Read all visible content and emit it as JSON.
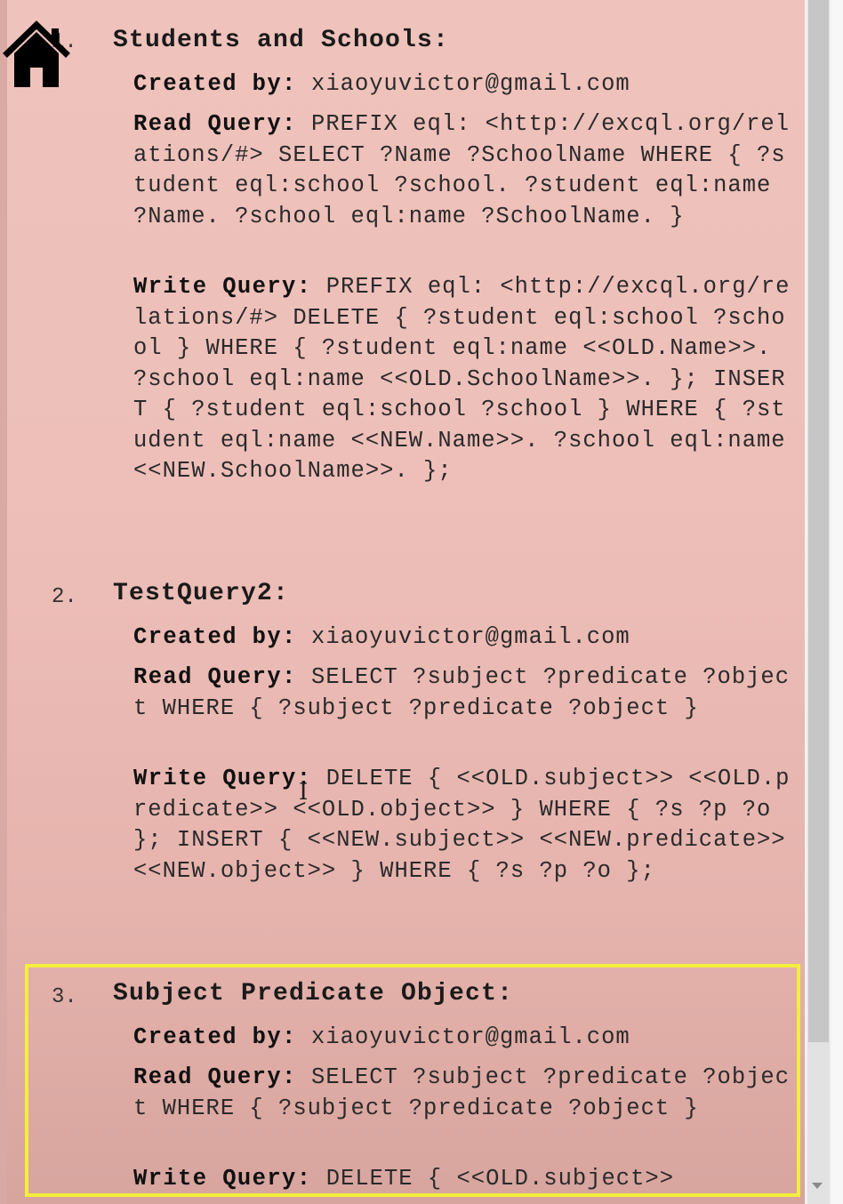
{
  "entries": [
    {
      "number": "1.",
      "title": "Students and Schools:",
      "created_label": "Created by:",
      "created_value": "xiaoyuvictor@gmail.com",
      "read_label": "Read Query:",
      "read_value": "PREFIX eql: <http://excql.org/relations/#> SELECT ?Name ?SchoolName WHERE { ?student eql:school ?school. ?student eql:name ?Name. ?school eql:name ?SchoolName. }",
      "write_label": "Write Query:",
      "write_value": "PREFIX eql: <http://excql.org/relations/#> DELETE { ?student eql:school ?school } WHERE { ?student eql:name <<OLD.Name>>. ?school eql:name <<OLD.SchoolName>>. }; INSERT { ?student eql:school ?school } WHERE { ?student eql:name <<NEW.Name>>. ?school eql:name <<NEW.SchoolName>>. };"
    },
    {
      "number": "2.",
      "title": "TestQuery2:",
      "created_label": "Created by:",
      "created_value": "xiaoyuvictor@gmail.com",
      "read_label": "Read Query:",
      "read_value": "SELECT ?subject ?predicate ?object WHERE { ?subject ?predicate ?object }",
      "write_label": "Write Query:",
      "write_value": "DELETE { <<OLD.subject>> <<OLD.predicate>> <<OLD.object>> } WHERE { ?s ?p ?o }; INSERT { <<NEW.subject>> <<NEW.predicate>> <<NEW.object>> } WHERE { ?s ?p ?o };"
    },
    {
      "number": "3.",
      "title": "Subject Predicate Object:",
      "created_label": "Created by:",
      "created_value": "xiaoyuvictor@gmail.com",
      "read_label": "Read Query:",
      "read_value": "SELECT ?subject ?predicate ?object WHERE { ?subject ?predicate ?object }",
      "write_label": "Write Query:",
      "write_value": "DELETE { <<OLD.subject>>"
    }
  ],
  "icons": {
    "home": "home-icon",
    "cursor": "text-cursor-icon"
  },
  "colors": {
    "background": "#efc1bb",
    "highlight": "#f4ee3c"
  }
}
